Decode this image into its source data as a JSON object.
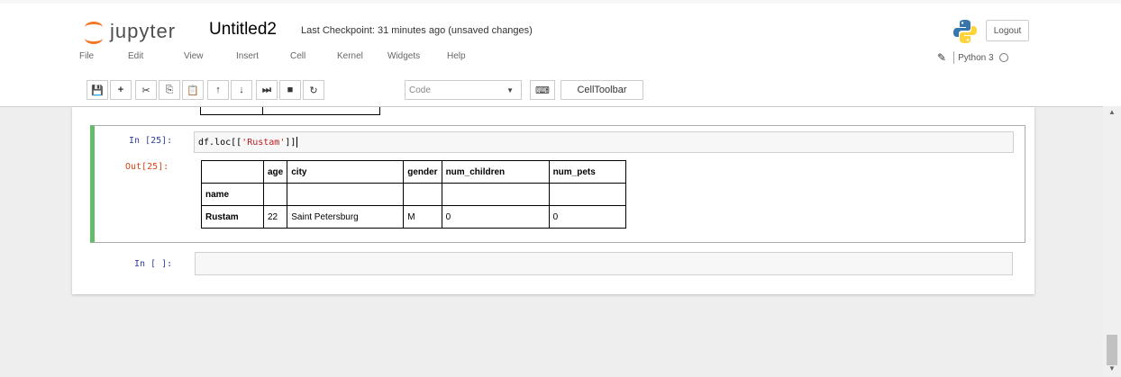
{
  "header": {
    "logo_text": "jupyter",
    "notebook_name": "Untitled2",
    "checkpoint": "Last Checkpoint: 31 minutes ago (unsaved changes)",
    "logout_label": "Logout"
  },
  "menu": {
    "items": [
      "File",
      "Edit",
      "View",
      "Insert",
      "Cell",
      "Kernel",
      "Widgets",
      "Help"
    ]
  },
  "kernel": {
    "name": "Python 3"
  },
  "toolbar": {
    "cell_type": "Code",
    "celltoolbar_label": "CellToolbar",
    "icons": [
      "save-icon",
      "add-cell-icon",
      "cut-icon",
      "copy-icon",
      "paste-icon",
      "move-up-icon",
      "move-down-icon",
      "run-icon",
      "stop-icon",
      "restart-icon",
      "keyboard-icon"
    ]
  },
  "cells": [
    {
      "in_prompt": "In [25]:",
      "code_prefix": "df.loc[[",
      "code_string": "'Rustam'",
      "code_suffix": "]]",
      "out_prompt": "Out[25]:",
      "table": {
        "columns": [
          "",
          "age",
          "city",
          "gender",
          "num_children",
          "num_pets"
        ],
        "index_name": "name",
        "rows": [
          [
            "Rustam",
            "22",
            "Saint Petersburg",
            "M",
            "0",
            "0"
          ]
        ]
      }
    },
    {
      "in_prompt": "In [ ]:"
    }
  ],
  "colors": {
    "accent_orange": "#f37726",
    "selected_cell_border": "#66bb6a",
    "in_prompt": "#303f9f",
    "out_prompt": "#d84315",
    "string_literal": "#ba2121"
  }
}
